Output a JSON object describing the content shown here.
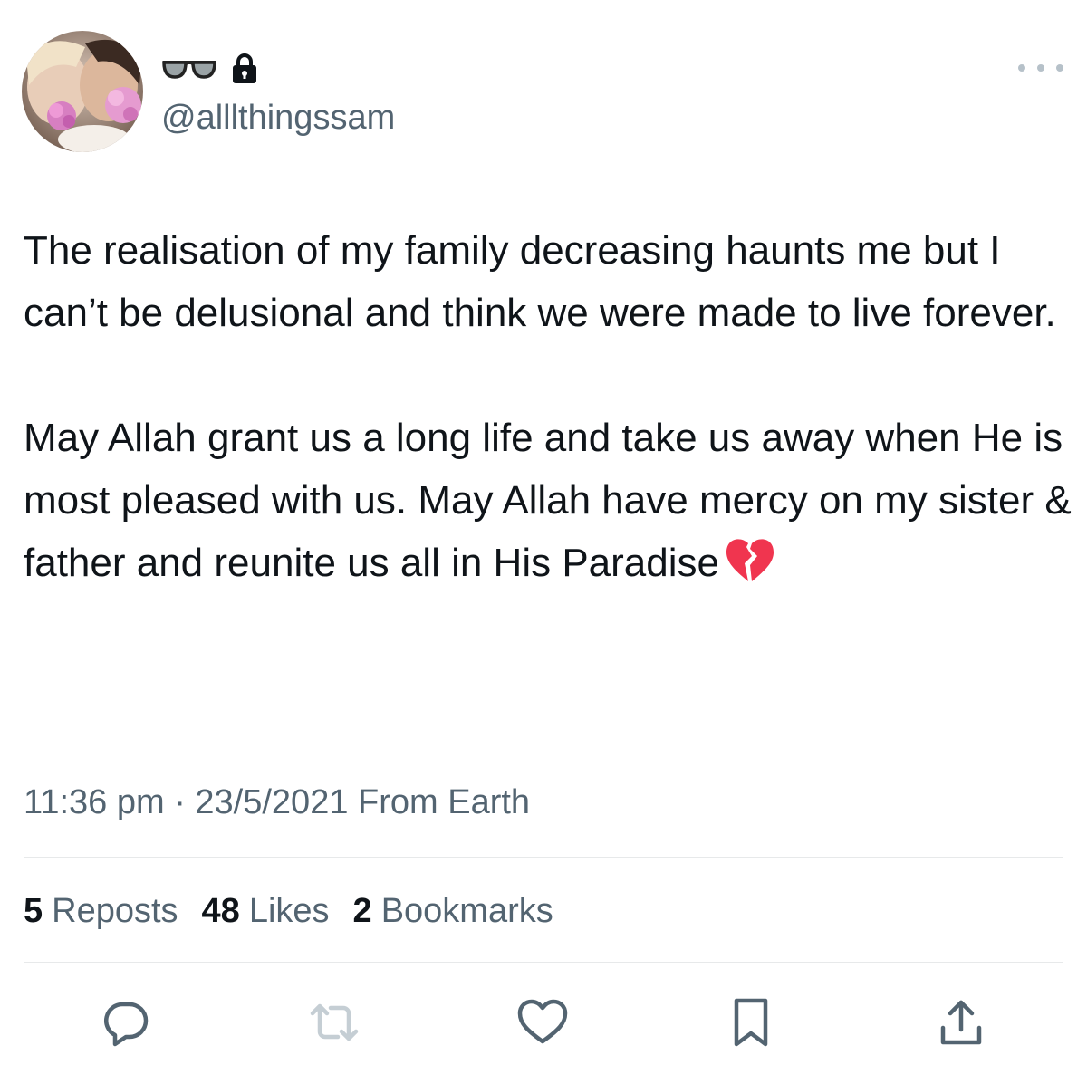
{
  "user": {
    "handle": "@alllthingssam",
    "display_name_icons": [
      "glasses-emoji",
      "lock-icon"
    ]
  },
  "tweet": {
    "paragraph_1": "The realisation of my family decreasing haunts me but I can’t be delusional and think we were made to live forever.",
    "paragraph_2": "May Allah grant us a long life and take us away when He is most pleased with us. May Allah have mercy on my sister & father and reunite us all in His Paradise",
    "emoji": "broken-heart-emoji"
  },
  "meta": {
    "time": "11:36 pm",
    "separator": "·",
    "date": "23/5/2021",
    "source": "From Earth"
  },
  "stats": {
    "reposts_count": "5",
    "reposts_label": "Reposts",
    "likes_count": "48",
    "likes_label": "Likes",
    "bookmarks_count": "2",
    "bookmarks_label": "Bookmarks"
  },
  "actions": [
    "reply-icon",
    "repost-icon",
    "like-icon",
    "bookmark-icon",
    "share-icon"
  ],
  "colors": {
    "text": "#0f1419",
    "secondary": "#536471",
    "divider": "#e7e9ea",
    "repost_disabled": "#c5ced4",
    "broken_heart": "#f0354f"
  }
}
